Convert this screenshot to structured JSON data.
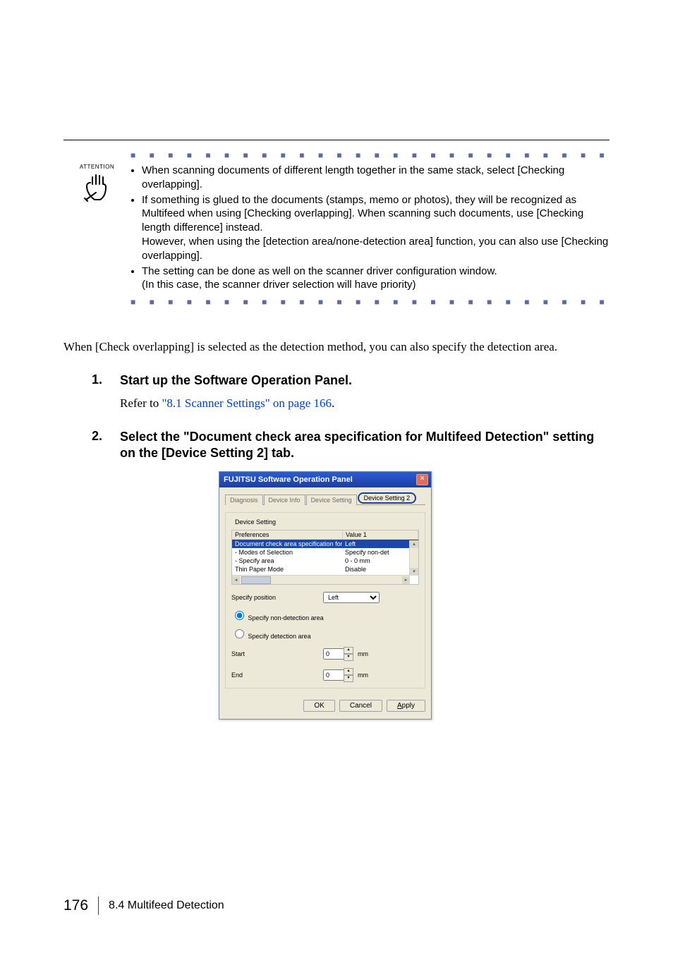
{
  "attention": {
    "label": "ATTENTION",
    "bullets": [
      "When scanning documents of different length together in the same stack, select [Checking overlapping].",
      "If something is glued to the documents (stamps, memo or photos), they will be recognized as Multifeed when using [Checking overlapping]. When scanning such documents, use [Checking length difference] instead.",
      "The setting can be done as well on the scanner driver configuration window."
    ],
    "bullet2_tail": "However, when using the [detection area/none-detection area] function, you can also use [Checking overlapping].",
    "bullet3_paren": "(In this case, the scanner driver selection will have priority)"
  },
  "body_para": "When [Check overlapping] is selected as the detection method, you can also specify the detection area.",
  "steps": {
    "s1": {
      "num": "1.",
      "title": "Start up the Software Operation Panel.",
      "refer_pre": "Refer to ",
      "refer_link": "\"8.1 Scanner Settings\" on page 166",
      "refer_post": "."
    },
    "s2": {
      "num": "2.",
      "title": "Select the \"Document check area specification for Multifeed Detection\" setting on the [Device Setting 2] tab."
    }
  },
  "dialog": {
    "title": "FUJITSU Software Operation Panel",
    "tabs": {
      "t1": "Diagnosis",
      "t2": "Device Info",
      "t3": "Device Setting",
      "t4": "Device Setting 2"
    },
    "group_label": "Device Setting",
    "lv_header": {
      "c1": "Preferences",
      "c2": "Value 1"
    },
    "lv_rows": [
      {
        "c1": "Document check area specification for ...",
        "c2": "Left",
        "sel": true
      },
      {
        "c1": "- Modes of Selection",
        "c2": "Specify non-det"
      },
      {
        "c1": "- Specify area",
        "c2": "0 - 0 mm"
      },
      {
        "c1": "Thin Paper Mode",
        "c2": "Disable"
      }
    ],
    "specify_position_label": "Specify position",
    "specify_position_value": "Left",
    "radio1": "Specify non-detection area",
    "radio2": "Specify detection area",
    "start_label": "Start",
    "start_value": "0",
    "end_label": "End",
    "end_value": "0",
    "unit": "mm",
    "buttons": {
      "ok": "OK",
      "cancel": "Cancel",
      "apply": "Apply"
    }
  },
  "footer": {
    "page": "176",
    "section": "8.4 Multifeed Detection"
  }
}
